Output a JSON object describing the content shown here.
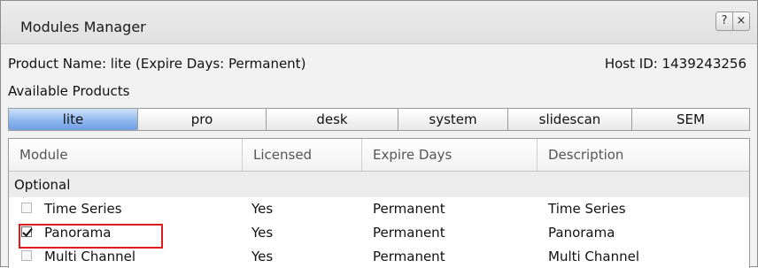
{
  "window": {
    "title": "Modules Manager",
    "help_label": "?",
    "close_label": "×"
  },
  "info": {
    "product_name": "Product Name: lite (Expire Days: Permanent)",
    "host_id": "Host ID: 1439243256",
    "available_products_label": "Available Products"
  },
  "tabs": [
    {
      "label": "lite",
      "active": true
    },
    {
      "label": "pro",
      "active": false
    },
    {
      "label": "desk",
      "active": false
    },
    {
      "label": "system",
      "active": false
    },
    {
      "label": "slidescan",
      "active": false
    },
    {
      "label": "SEM",
      "active": false
    }
  ],
  "table": {
    "columns": [
      "Module",
      "Licensed",
      "Expire Days",
      "Description"
    ],
    "group_label": "Optional",
    "rows": [
      {
        "module": "Time Series",
        "licensed": "Yes",
        "expire_days": "Permanent",
        "description": "Time Series",
        "checked": false
      },
      {
        "module": "Panorama",
        "licensed": "Yes",
        "expire_days": "Permanent",
        "description": "Panorama",
        "checked": true
      },
      {
        "module": "Multi Channel",
        "licensed": "Yes",
        "expire_days": "Permanent",
        "description": "Multi Channel",
        "checked": false
      }
    ]
  },
  "colors": {
    "active_tab": "#8fb7ee",
    "highlight": "#e0191e"
  }
}
